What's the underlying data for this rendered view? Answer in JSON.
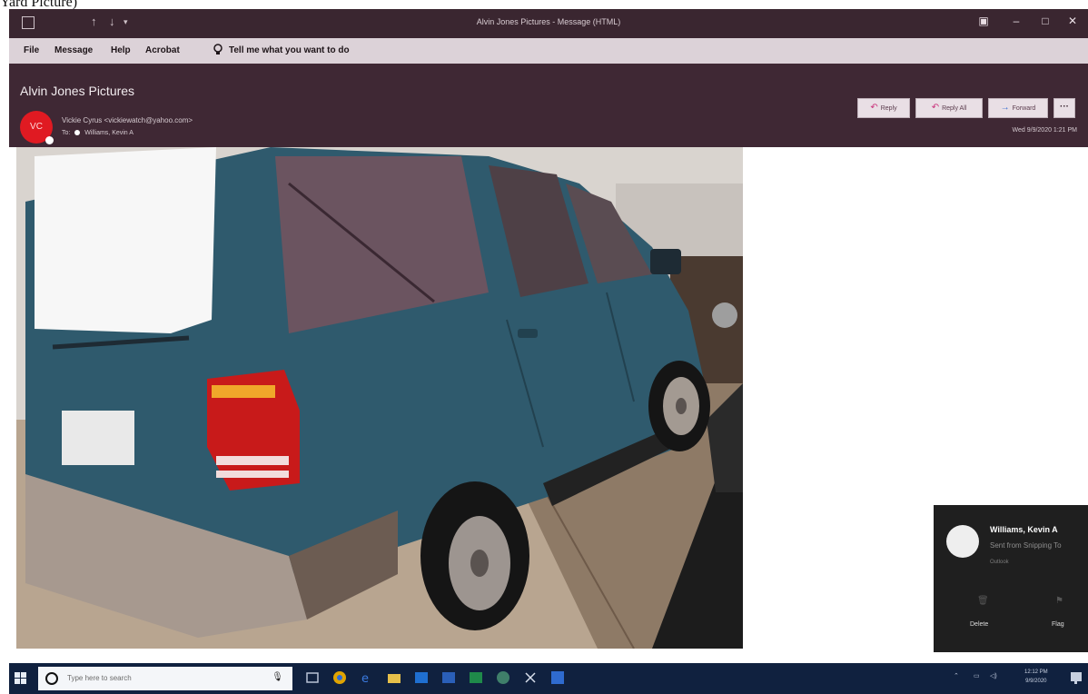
{
  "caption": "Yard Picture)",
  "window": {
    "title": "Alvin Jones Pictures - Message (HTML)",
    "controls": {
      "minimize": "–",
      "maximize": "□",
      "close": "✕"
    }
  },
  "menu": {
    "items": [
      "File",
      "Message",
      "Help",
      "Acrobat"
    ],
    "tell_me": "Tell me what you want to do"
  },
  "message": {
    "subject": "Alvin Jones Pictures",
    "avatar_initials": "VC",
    "from": "Vickie Cyrus <vickiewatch@yahoo.com>",
    "to_label": "To",
    "to": "Williams, Kevin A",
    "date": "Wed 9/9/2020 1:21 PM",
    "actions": {
      "reply": "Reply",
      "reply_all": "Reply All",
      "forward": "Forward",
      "more": "···"
    }
  },
  "toast": {
    "name": "Williams, Kevin A",
    "message": "Sent from Snipping To",
    "source": "Outlook",
    "delete": "Delete",
    "flag": "Flag"
  },
  "taskbar": {
    "search_placeholder": "Type here to search",
    "time": "12:12 PM",
    "date": "9/9/2020"
  },
  "colors": {
    "titlebar": "#3a2630",
    "header": "#3f2834",
    "menubar": "#dcd2d8",
    "avatar": "#e01a22",
    "taskbar": "#10213f",
    "vehicle": "#2f5a6d"
  },
  "icons": {
    "save": "save-icon",
    "undo": "undo-icon",
    "lightbulb": "lightbulb-icon",
    "reply": "reply-icon",
    "reply_all": "reply-all-icon",
    "forward": "forward-icon"
  }
}
